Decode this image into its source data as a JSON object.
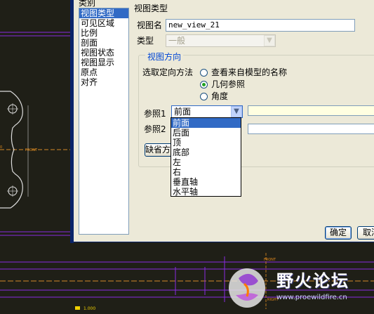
{
  "dialog": {
    "category_label": "类别",
    "categories": [
      {
        "label": "视图类型",
        "selected": true
      },
      {
        "label": "可见区域",
        "selected": false
      },
      {
        "label": "比例",
        "selected": false
      },
      {
        "label": "剖面",
        "selected": false
      },
      {
        "label": "视图状态",
        "selected": false
      },
      {
        "label": "视图显示",
        "selected": false
      },
      {
        "label": "原点",
        "selected": false
      },
      {
        "label": "对齐",
        "selected": false
      }
    ],
    "section_title": "视图类型",
    "view_name_label": "视图名",
    "view_name_value": "new_view_21",
    "type_label": "类型",
    "type_value": "一般",
    "orientation_group_title": "视图方向",
    "orientation_method_label": "选取定向方法",
    "orientation_options": [
      "查看来自模型的名称",
      "几何参照",
      "角度"
    ],
    "orientation_selected": "几何参照",
    "ref1_label": "参照1",
    "ref1_value": "前面",
    "ref2_label": "参照2",
    "default_button": "缺省方向",
    "ok_button": "确定",
    "cancel_button": "取消",
    "ref_dropdown_options": [
      "前面",
      "后面",
      "顶",
      "底部",
      "左",
      "右",
      "垂直轴",
      "水平轴"
    ],
    "ref_dropdown_selected": "前面"
  },
  "cad": {
    "front_label": "FRONT",
    "right_label": "RIGHT",
    "scale_text": "1.000"
  },
  "watermark": {
    "title": "野火论坛",
    "url": "www.proewildfire.cn"
  },
  "colors": {
    "dialog_bg": "#ece9d8",
    "selection": "#316ac5",
    "cad_bg": "#1f1f17",
    "cad_purple": "#8a2be2",
    "cad_orange": "#e08a1e"
  }
}
